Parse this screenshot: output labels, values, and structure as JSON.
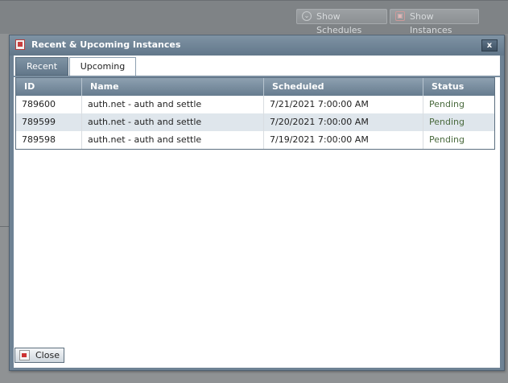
{
  "background": {
    "buttons": [
      {
        "label": "Show Schedules",
        "icon": "chevron-down-circle-icon"
      },
      {
        "label": "Show Instances",
        "icon": "instances-icon"
      }
    ]
  },
  "dialog": {
    "title": "Recent & Upcoming Instances",
    "close_glyph": "x",
    "tabs": [
      {
        "label": "Recent",
        "active": false
      },
      {
        "label": "Upcoming",
        "active": true
      }
    ],
    "grid": {
      "columns": [
        "ID",
        "Name",
        "Scheduled",
        "Status"
      ],
      "rows": [
        {
          "id": "789600",
          "name": "auth.net - auth and settle",
          "scheduled": "7/21/2021 7:00:00 AM",
          "status": "Pending"
        },
        {
          "id": "789599",
          "name": "auth.net - auth and settle",
          "scheduled": "7/20/2021 7:00:00 AM",
          "status": "Pending"
        },
        {
          "id": "789598",
          "name": "auth.net - auth and settle",
          "scheduled": "7/19/2021 7:00:00 AM",
          "status": "Pending"
        }
      ]
    },
    "footer": {
      "close_label": "Close"
    }
  }
}
